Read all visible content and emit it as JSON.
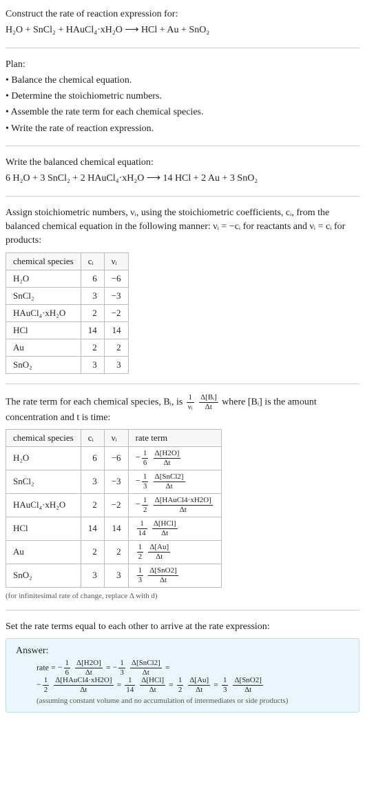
{
  "intro": {
    "prompt": "Construct the rate of reaction expression for:",
    "unbalanced": "H₂O + SnCl₂ + HAuCl₄·xH₂O  ⟶  HCl + Au + SnO₂"
  },
  "plan": {
    "heading": "Plan:",
    "items": [
      "• Balance the chemical equation.",
      "• Determine the stoichiometric numbers.",
      "• Assemble the rate term for each chemical species.",
      "• Write the rate of reaction expression."
    ]
  },
  "balanced": {
    "heading": "Write the balanced chemical equation:",
    "equation": "6 H₂O + 3 SnCl₂ + 2 HAuCl₄·xH₂O  ⟶  14 HCl + 2 Au + 3 SnO₂"
  },
  "stoich": {
    "intro1": "Assign stoichiometric numbers, νᵢ, using the stoichiometric coefficients, cᵢ, from the balanced chemical equation in the following manner: νᵢ = −cᵢ for reactants and νᵢ = cᵢ for products:",
    "headers": [
      "chemical species",
      "cᵢ",
      "νᵢ"
    ],
    "rows": [
      {
        "sp": "H₂O",
        "c": "6",
        "v": "−6"
      },
      {
        "sp": "SnCl₂",
        "c": "3",
        "v": "−3"
      },
      {
        "sp": "HAuCl₄·xH₂O",
        "c": "2",
        "v": "−2"
      },
      {
        "sp": "HCl",
        "c": "14",
        "v": "14"
      },
      {
        "sp": "Au",
        "c": "2",
        "v": "2"
      },
      {
        "sp": "SnO₂",
        "c": "3",
        "v": "3"
      }
    ]
  },
  "rate_terms": {
    "intro_prefix": "The rate term for each chemical species, Bᵢ, is ",
    "intro_suffix": " where [Bᵢ] is the amount concentration and t is time:",
    "f1_num": "1",
    "f1_den": "νᵢ",
    "f2_num": "Δ[Bᵢ]",
    "f2_den": "Δt",
    "headers": [
      "chemical species",
      "cᵢ",
      "νᵢ",
      "rate term"
    ],
    "rows": [
      {
        "sp": "H₂O",
        "c": "6",
        "v": "−6",
        "sign": "−",
        "fn": "1",
        "fd": "6",
        "dn": "Δ[H2O]",
        "dd": "Δt"
      },
      {
        "sp": "SnCl₂",
        "c": "3",
        "v": "−3",
        "sign": "−",
        "fn": "1",
        "fd": "3",
        "dn": "Δ[SnCl2]",
        "dd": "Δt"
      },
      {
        "sp": "HAuCl₄·xH₂O",
        "c": "2",
        "v": "−2",
        "sign": "−",
        "fn": "1",
        "fd": "2",
        "dn": "Δ[HAuCl4·xH2O]",
        "dd": "Δt"
      },
      {
        "sp": "HCl",
        "c": "14",
        "v": "14",
        "sign": "",
        "fn": "1",
        "fd": "14",
        "dn": "Δ[HCl]",
        "dd": "Δt"
      },
      {
        "sp": "Au",
        "c": "2",
        "v": "2",
        "sign": "",
        "fn": "1",
        "fd": "2",
        "dn": "Δ[Au]",
        "dd": "Δt"
      },
      {
        "sp": "SnO₂",
        "c": "3",
        "v": "3",
        "sign": "",
        "fn": "1",
        "fd": "3",
        "dn": "Δ[SnO2]",
        "dd": "Δt"
      }
    ],
    "note": "(for infinitesimal rate of change, replace Δ with d)"
  },
  "final": {
    "heading": "Set the rate terms equal to each other to arrive at the rate expression:"
  },
  "answer": {
    "title": "Answer:",
    "prefix": "rate = ",
    "eq": " = ",
    "terms": [
      {
        "sign": "−",
        "fn": "1",
        "fd": "6",
        "dn": "Δ[H2O]",
        "dd": "Δt"
      },
      {
        "sign": "−",
        "fn": "1",
        "fd": "3",
        "dn": "Δ[SnCl2]",
        "dd": "Δt"
      },
      {
        "sign": "−",
        "fn": "1",
        "fd": "2",
        "dn": "Δ[HAuCl4·xH2O]",
        "dd": "Δt"
      },
      {
        "sign": "",
        "fn": "1",
        "fd": "14",
        "dn": "Δ[HCl]",
        "dd": "Δt"
      },
      {
        "sign": "",
        "fn": "1",
        "fd": "2",
        "dn": "Δ[Au]",
        "dd": "Δt"
      },
      {
        "sign": "",
        "fn": "1",
        "fd": "3",
        "dn": "Δ[SnO2]",
        "dd": "Δt"
      }
    ],
    "assume": "(assuming constant volume and no accumulation of intermediates or side products)"
  },
  "chart_data": {
    "type": "table",
    "title": "Stoichiometric numbers and rate terms",
    "species": [
      "H2O",
      "SnCl2",
      "HAuCl4·xH2O",
      "HCl",
      "Au",
      "SnO2"
    ],
    "c_i": [
      6,
      3,
      2,
      14,
      2,
      3
    ],
    "nu_i": [
      -6,
      -3,
      -2,
      14,
      2,
      3
    ],
    "rate_terms": [
      "-(1/6) Δ[H2O]/Δt",
      "-(1/3) Δ[SnCl2]/Δt",
      "-(1/2) Δ[HAuCl4·xH2O]/Δt",
      "(1/14) Δ[HCl]/Δt",
      "(1/2) Δ[Au]/Δt",
      "(1/3) Δ[SnO2]/Δt"
    ],
    "rate_expression": "rate = -(1/6) Δ[H2O]/Δt = -(1/3) Δ[SnCl2]/Δt = -(1/2) Δ[HAuCl4·xH2O]/Δt = (1/14) Δ[HCl]/Δt = (1/2) Δ[Au]/Δt = (1/3) Δ[SnO2]/Δt"
  }
}
